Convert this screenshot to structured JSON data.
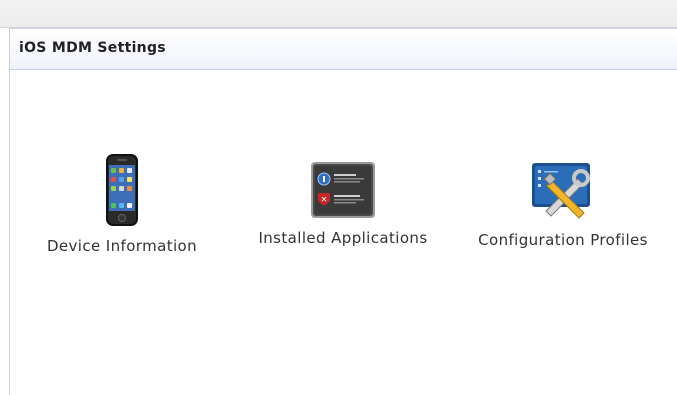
{
  "header": {
    "title": "iOS MDM Settings"
  },
  "items": [
    {
      "label": "Device Information",
      "icon": "iphone-icon"
    },
    {
      "label": "Installed Applications",
      "icon": "app-list-icon"
    },
    {
      "label": "Configuration Profiles",
      "icon": "tools-icon"
    }
  ],
  "colors": {
    "header_border": "#c9d3ec",
    "text": "#333333"
  }
}
